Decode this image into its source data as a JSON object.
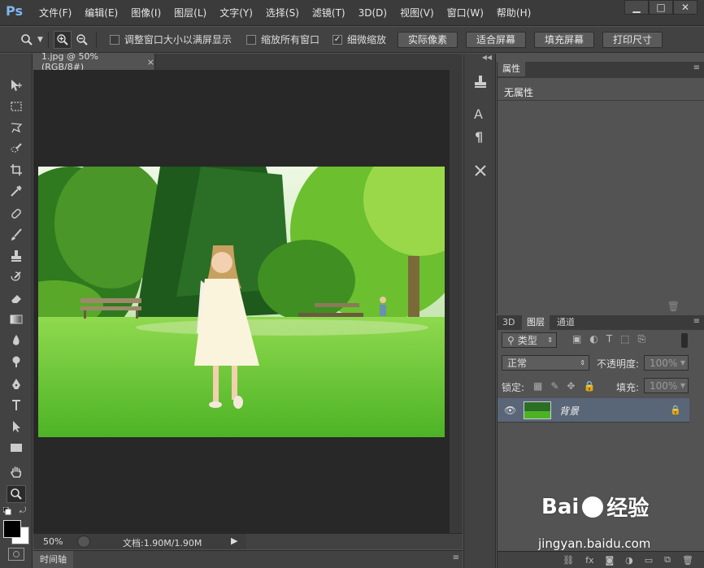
{
  "app": {
    "logo": "Ps"
  },
  "menu": [
    "文件(F)",
    "编辑(E)",
    "图像(I)",
    "图层(L)",
    "文字(Y)",
    "选择(S)",
    "滤镜(T)",
    "3D(D)",
    "视图(V)",
    "窗口(W)",
    "帮助(H)"
  ],
  "window_controls": {
    "minimize": "▁",
    "maximize": "□",
    "close": "✕"
  },
  "options": {
    "resize_windows": "调整窗口大小以满屏显示",
    "zoom_all": "缩放所有窗口",
    "scrubby_zoom": "细微缩放",
    "actual_pixels": "实际像素",
    "fit_screen": "适合屏幕",
    "fill_screen": "填充屏幕",
    "print_size": "打印尺寸"
  },
  "document": {
    "tab_title": "1.jpg @ 50%(RGB/8#)",
    "close": "×",
    "zoom": "50%",
    "doc_size": "文档:1.90M/1.90M"
  },
  "timeline": {
    "label": "时间轴"
  },
  "properties": {
    "tab": "属性",
    "empty": "无属性"
  },
  "layers_panel": {
    "tabs": [
      "3D",
      "图层",
      "通道"
    ],
    "filter_kind": "类型",
    "blend_mode": "正常",
    "opacity_label": "不透明度:",
    "opacity_value": "100%",
    "lock_label": "锁定:",
    "fill_label": "填充:",
    "fill_value": "100%",
    "layer_name": "背景"
  },
  "mid_panel": {
    "char_icon": "A",
    "para_icon": "¶"
  },
  "watermark": {
    "brand": "Bai",
    "cn": "经验",
    "url": "jingyan.baidu.com"
  }
}
